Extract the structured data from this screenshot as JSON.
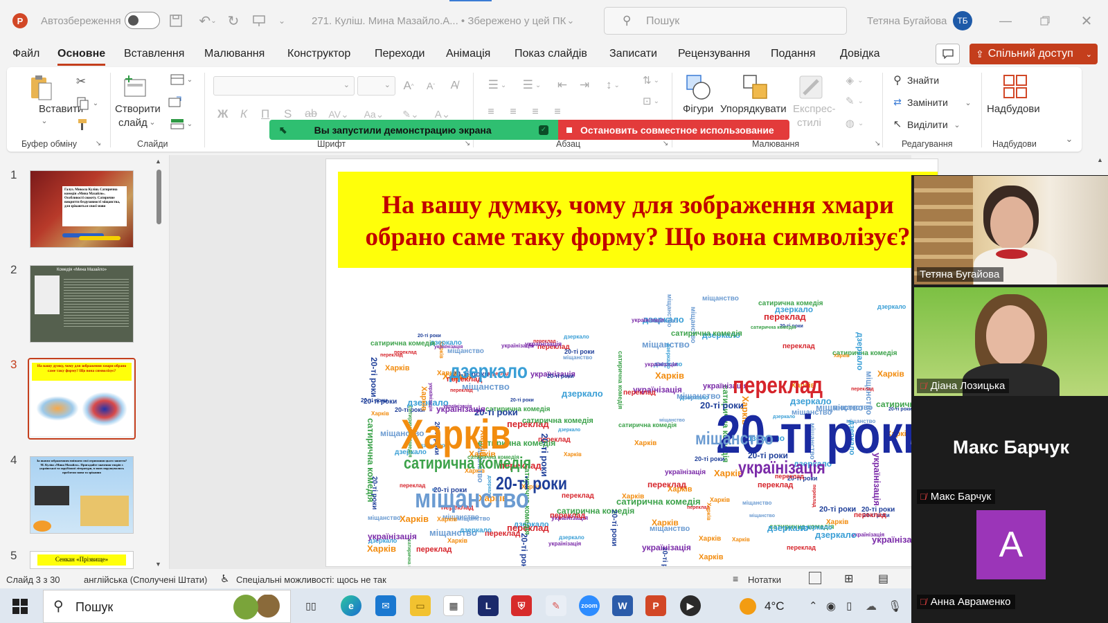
{
  "titlebar": {
    "autosave_label": "Автозбереження",
    "doc_title": "271. Куліш. Мина Мазайло.А...  •  Збережено у цей ПК",
    "search_placeholder": "Пошук",
    "user_name": "Тетяна Бугайова",
    "user_initials": "ТБ"
  },
  "menu": {
    "tabs": [
      "Файл",
      "Основне",
      "Вставлення",
      "Малювання",
      "Конструктор",
      "Переходи",
      "Анімація",
      "Показ слайдів",
      "Записати",
      "Рецензування",
      "Подання",
      "Довідка"
    ],
    "active_tab": "Основне",
    "share_label": "Спільний доступ"
  },
  "ribbon": {
    "paste": "Вставити",
    "new_slide": [
      "Створити",
      "слайд"
    ],
    "shapes": "Фігури",
    "arrange": "Упорядкувати",
    "quick_styles": [
      "Експрес-",
      "стилі"
    ],
    "find": "Знайти",
    "replace": "Замінити",
    "select": "Виділити",
    "addins": "Надбудови",
    "font_bold": "Ж",
    "font_italic": "К",
    "font_underline": "П",
    "font_strike": "S",
    "groups": [
      "Буфер обміну",
      "Слайди",
      "Шрифт",
      "Абзац",
      "Малювання",
      "Редагування",
      "Надбудови"
    ]
  },
  "share_banner": {
    "green_text": "Вы запустили демонстрацию экрана",
    "red_text": "Остановить совместное использование"
  },
  "thumbnails": {
    "numbers": [
      "1",
      "2",
      "3",
      "4",
      "5"
    ],
    "t1_text": "Галуз. Микола Куліш. Сатирична комедія «Мина Мазайло». Особливості сюжету. Сатиричне викриття бездуховності міщанства, для зрікаються своєї мови",
    "t2_title": "Комедія «Мина Мазайло»",
    "t3_title": "На вашу думку, чому для зображення хмари обрано саме таку форму? Що вона символізує?",
    "t4_text": "За якими зображенням впізнати свої отримання цього заняття? М. Куліш «Мина Мазайло». Пригадайте значення творів з української та зарубіжної літератури, в яких порушувались проблеми мови та зрікання",
    "t5_text": "Сенкан «Прізвище»"
  },
  "slide": {
    "title_line1": "На вашу думку, чому для зображення хмари",
    "title_line2": "обрано саме таку форму? Що вона символізує?",
    "left_cloud": [
      {
        "t": "Харків",
        "c": "#f28c0f",
        "s": 60
      },
      {
        "t": "міщанство",
        "c": "#6b9bd1",
        "s": 38
      },
      {
        "t": "сатирична комедія",
        "c": "#3ca24a",
        "s": 24
      },
      {
        "t": "дзеркало",
        "c": "#3a9fd6",
        "s": 30
      },
      {
        "t": "20-ті роки",
        "c": "#1f3f99",
        "s": 26
      }
    ],
    "right_cloud": [
      {
        "t": "20-ті роки",
        "c": "#1a2aa0",
        "s": 78
      },
      {
        "t": "переклад",
        "c": "#d6242b",
        "s": 34
      },
      {
        "t": "українізація",
        "c": "#7a2aa8",
        "s": 26
      },
      {
        "t": "міщанство",
        "c": "#6b9bd1",
        "s": 26
      }
    ]
  },
  "participants": [
    {
      "name": "Тетяна Бугайова"
    },
    {
      "name": "Діана Лозицька"
    },
    {
      "name": "Макс Барчук",
      "big": "Макс Барчук"
    },
    {
      "name": "Анна Авраменко",
      "initial": "A",
      "color": "#9b35b8"
    }
  ],
  "statusbar": {
    "slide_info": "Слайд 3 з 30",
    "language": "англійська (Сполучені Штати)",
    "accessibility": "Спеціальні можливості: щось не так",
    "notes": "Нотатки"
  },
  "taskbar": {
    "search": "Пошук",
    "temperature": "4°C"
  }
}
